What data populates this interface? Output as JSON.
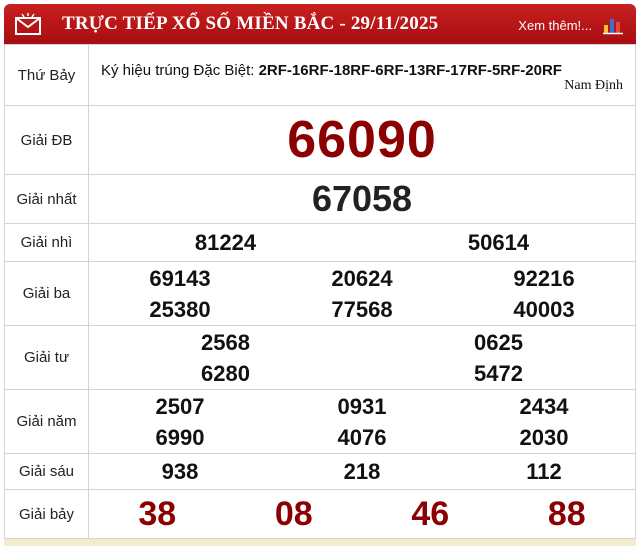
{
  "header": {
    "title": "TRỰC TIẾP XỔ SỐ MIỀN BẮC - 29/11/2025",
    "more_link": "Xem thêm!...",
    "colors": {
      "header_bg": "#b5141a",
      "highlight_number": "#8b0000"
    },
    "icons": [
      "mail-icon",
      "bar-chart-icon"
    ]
  },
  "info": {
    "day": "Thứ Bảy",
    "special_symbol_label": "Ký hiệu trúng Đặc Biệt:",
    "special_symbol_value": "2RF-16RF-18RF-6RF-13RF-17RF-5RF-20RF",
    "province": "Nam Định"
  },
  "prizes": {
    "db": {
      "label": "Giải ĐB",
      "numbers": [
        "66090"
      ]
    },
    "nhat": {
      "label": "Giải nhất",
      "numbers": [
        "67058"
      ]
    },
    "nhi": {
      "label": "Giải nhì",
      "numbers": [
        "81224",
        "50614"
      ]
    },
    "ba": {
      "label": "Giải ba",
      "numbers": [
        "69143",
        "20624",
        "92216",
        "25380",
        "77568",
        "40003"
      ]
    },
    "tu": {
      "label": "Giải tư",
      "numbers": [
        "2568",
        "0625",
        "6280",
        "5472"
      ]
    },
    "nam": {
      "label": "Giải năm",
      "numbers": [
        "2507",
        "0931",
        "2434",
        "6990",
        "4076",
        "2030"
      ]
    },
    "sau": {
      "label": "Giải sáu",
      "numbers": [
        "938",
        "218",
        "112"
      ]
    },
    "bay": {
      "label": "Giải bảy",
      "numbers": [
        "38",
        "08",
        "46",
        "88"
      ]
    }
  }
}
